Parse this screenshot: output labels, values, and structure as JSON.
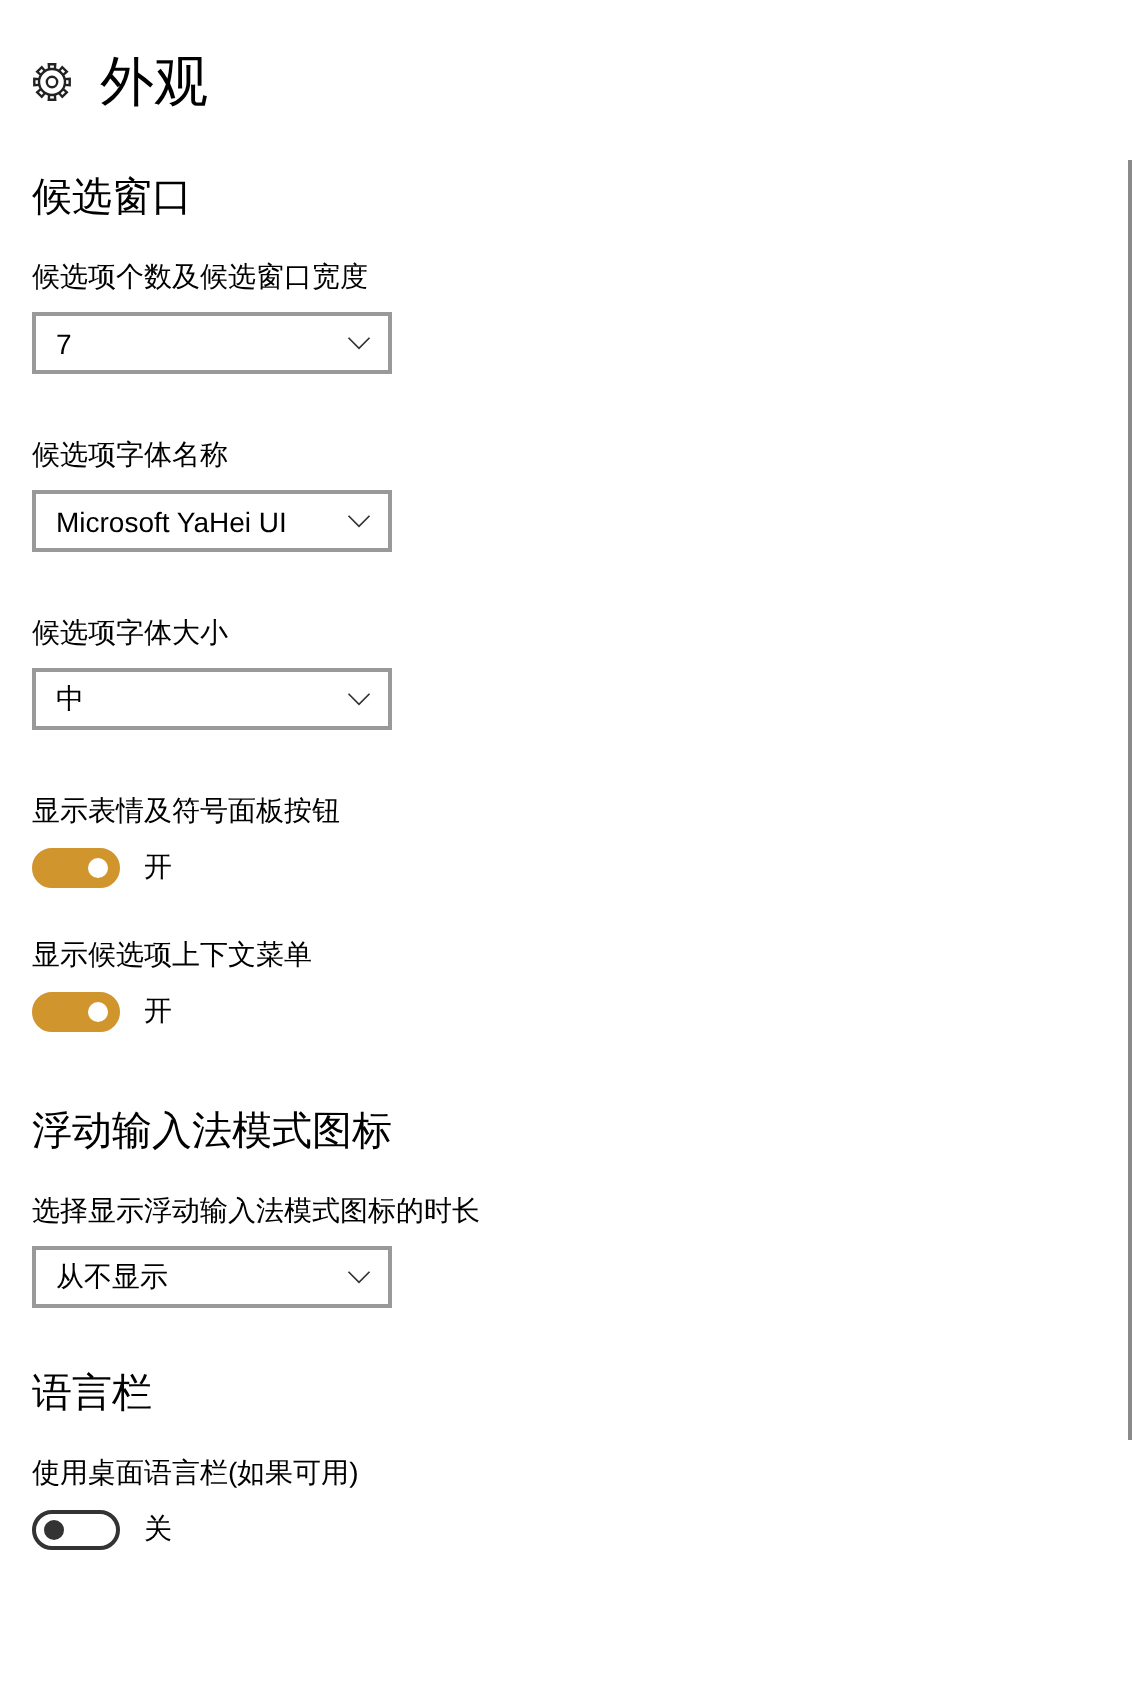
{
  "page": {
    "title": "外观"
  },
  "sections": [
    {
      "heading": "候选窗口",
      "items": [
        {
          "kind": "dropdown",
          "label": "候选项个数及候选窗口宽度",
          "value": "7"
        },
        {
          "kind": "dropdown",
          "label": "候选项字体名称",
          "value": "Microsoft YaHei UI"
        },
        {
          "kind": "dropdown",
          "label": "候选项字体大小",
          "value": "中"
        },
        {
          "kind": "toggle",
          "label": "显示表情及符号面板按钮",
          "on": true,
          "state_text": "开"
        },
        {
          "kind": "toggle",
          "label": "显示候选项上下文菜单",
          "on": true,
          "state_text": "开"
        }
      ]
    },
    {
      "heading": "浮动输入法模式图标",
      "items": [
        {
          "kind": "dropdown",
          "label": "选择显示浮动输入法模式图标的时长",
          "value": "从不显示"
        }
      ]
    },
    {
      "heading": "语言栏",
      "items": [
        {
          "kind": "toggle",
          "label": "使用桌面语言栏(如果可用)",
          "on": false,
          "state_text": "关"
        }
      ]
    }
  ]
}
